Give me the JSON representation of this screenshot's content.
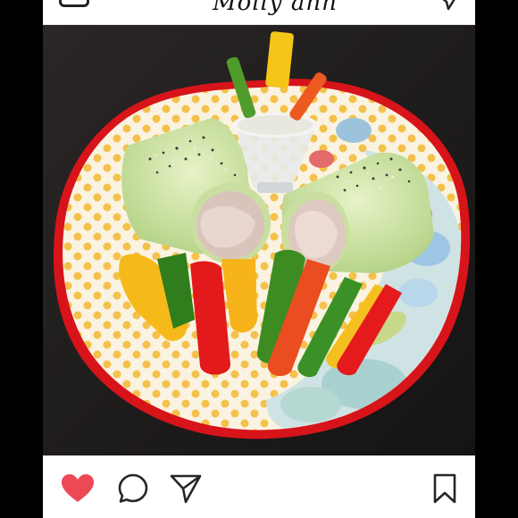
{
  "app": {
    "header_text": "Molly ann"
  },
  "icons": {
    "camera": "camera-icon",
    "direct": "direct-message-icon",
    "like": "heart-icon",
    "comment": "comment-icon",
    "share": "share-icon",
    "save": "bookmark-icon"
  },
  "colors": {
    "like_red": "#ec4954",
    "icon_dark": "#262626",
    "plate_rim": "#d7141a"
  },
  "post": {
    "liked": true
  }
}
